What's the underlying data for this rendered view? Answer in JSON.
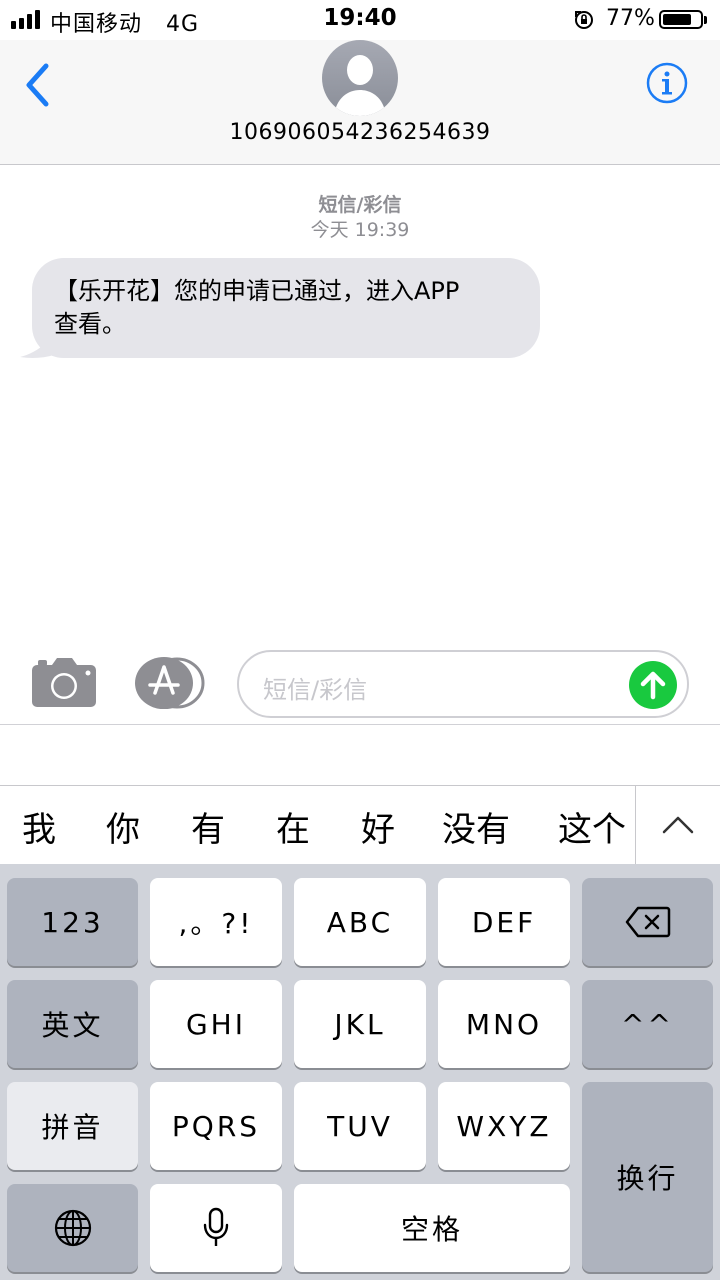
{
  "status_bar": {
    "carrier": "中国移动",
    "network": "4G",
    "time": "19:40",
    "battery_percent": "77%",
    "battery_level": 0.77
  },
  "header": {
    "contact": "106906054236254639",
    "back_icon": "chevron-left-icon",
    "info_icon": "info-icon",
    "accent_color": "#1b7cf5"
  },
  "conversation": {
    "meta_type": "短信/彩信",
    "meta_time": "今天 19:39",
    "messages": [
      {
        "direction": "incoming",
        "text_line1": "【乐开花】您的申请已通过，进入APP",
        "text_line2": "查看。"
      }
    ]
  },
  "input_bar": {
    "placeholder": "短信/彩信",
    "camera_icon": "camera-icon",
    "appstore_icon": "app-store-icon",
    "send_icon": "send-arrow-icon",
    "send_color": "#19c93f"
  },
  "candidates": {
    "items": [
      "我",
      "你",
      "有",
      "在",
      "好",
      "没有",
      "这个"
    ],
    "expand_icon": "chevron-up-icon"
  },
  "keyboard": {
    "row1": {
      "left": "123",
      "keys": [
        ",。?!",
        "ABC",
        "DEF"
      ],
      "right_icon": "delete-icon"
    },
    "row2": {
      "left": "英文",
      "keys": [
        "GHI",
        "JKL",
        "MNO"
      ],
      "right": "^^"
    },
    "row3": {
      "left": "拼音",
      "keys": [
        "PQRS",
        "TUV",
        "WXYZ"
      ],
      "right": "换行"
    },
    "row4": {
      "globe_icon": "globe-icon",
      "mic_icon": "microphone-icon",
      "space": "空格"
    }
  }
}
